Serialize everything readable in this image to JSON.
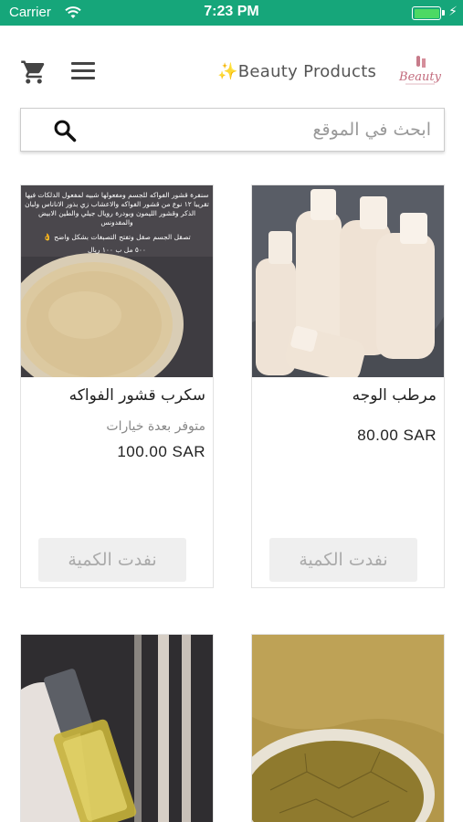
{
  "status_bar": {
    "carrier": "Carrier",
    "time": "7:23 PM",
    "battery_level": 1.0
  },
  "header": {
    "brand_name": "✨Beauty Products",
    "logo_text": "Beauty",
    "icons": [
      "cart-icon",
      "menu-icon"
    ]
  },
  "search": {
    "placeholder": "ابحث في الموقع",
    "icon": "search-icon"
  },
  "products": [
    {
      "name": "مرطب الوجه",
      "options_note": "",
      "price": "80.00 SAR",
      "button_label": "نفدت الكمية"
    },
    {
      "name": "سكرب قشور الفواكه",
      "options_note": "متوفر بعدة خيارات",
      "price": "100.00 SAR",
      "button_label": "نفدت الكمية",
      "image_caption": "سنفرة قشور الفواكه للجسم ومفعولها شبيه لمفعول الدلكات فيها تقريبا ١٢ نوع من قشور الفواكه والاعشاب زي بذور الاناناس ولبان الذكر وقشور الليمون وبودرة رويال جيلي والطين الابيض والمقدونس",
      "image_caption_2": "تصقل الجسم صقل وتفتح التصبغات بشكل واضح 👌",
      "image_caption_3": "٥٠٠ مل ب ١٠٠ ريال"
    },
    {
      "name": "",
      "price": ""
    },
    {
      "name": "",
      "price": ""
    }
  ],
  "colors": {
    "status_bar": "#16a67a",
    "battery": "#4cd964"
  }
}
